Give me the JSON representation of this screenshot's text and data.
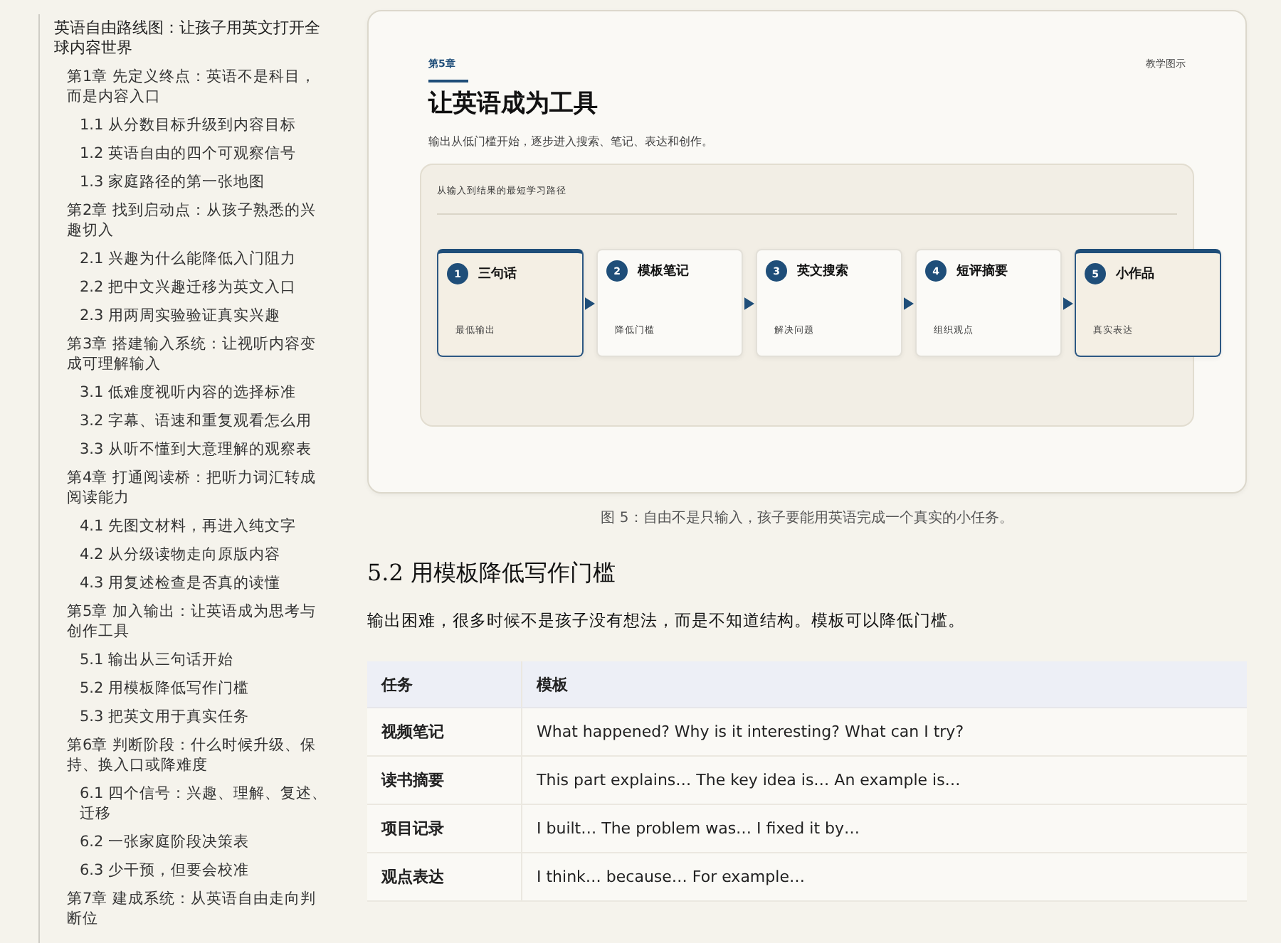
{
  "sidebar": {
    "toc": [
      {
        "label": "英语自由路线图：让孩子用英文打开全球内容世界",
        "children": [
          {
            "label": "第1章 先定义终点：英语不是科目，而是内容入口",
            "children": [
              {
                "label": "1.1 从分数目标升级到内容目标"
              },
              {
                "label": "1.2 英语自由的四个可观察信号"
              },
              {
                "label": "1.3 家庭路径的第一张地图"
              }
            ]
          },
          {
            "label": "第2章 找到启动点：从孩子熟悉的兴趣切入",
            "children": [
              {
                "label": "2.1 兴趣为什么能降低入门阻力"
              },
              {
                "label": "2.2 把中文兴趣迁移为英文入口"
              },
              {
                "label": "2.3 用两周实验验证真实兴趣"
              }
            ]
          },
          {
            "label": "第3章 搭建输入系统：让视听内容变成可理解输入",
            "children": [
              {
                "label": "3.1 低难度视听内容的选择标准"
              },
              {
                "label": "3.2 字幕、语速和重复观看怎么用"
              },
              {
                "label": "3.3 从听不懂到大意理解的观察表"
              }
            ]
          },
          {
            "label": "第4章 打通阅读桥：把听力词汇转成阅读能力",
            "children": [
              {
                "label": "4.1 先图文材料，再进入纯文字"
              },
              {
                "label": "4.2 从分级读物走向原版内容"
              },
              {
                "label": "4.3 用复述检查是否真的读懂"
              }
            ]
          },
          {
            "label": "第5章 加入输出：让英语成为思考与创作工具",
            "children": [
              {
                "label": "5.1 输出从三句话开始"
              },
              {
                "label": "5.2 用模板降低写作门槛"
              },
              {
                "label": "5.3 把英文用于真实任务"
              }
            ]
          },
          {
            "label": "第6章 判断阶段：什么时候升级、保持、换入口或降难度",
            "children": [
              {
                "label": "6.1 四个信号：兴趣、理解、复述、迁移"
              },
              {
                "label": "6.2 一张家庭阶段决策表"
              },
              {
                "label": "6.3 少干预，但要会校准"
              }
            ]
          },
          {
            "label": "第7章 建成系统：从英语自由走向判断位"
          }
        ]
      }
    ]
  },
  "figure": {
    "chapter": "第5章",
    "tag": "教学图示",
    "title": "让英语成为工具",
    "subtitle": "输出从低门槛开始，逐步进入搜索、笔记、表达和创作。",
    "panel_title": "从输入到结果的最短学习路径",
    "steps": [
      {
        "number": "1",
        "title": "三句话",
        "note": "最低输出",
        "highlighted": true
      },
      {
        "number": "2",
        "title": "模板笔记",
        "note": "降低门槛",
        "highlighted": false
      },
      {
        "number": "3",
        "title": "英文搜索",
        "note": "解决问题",
        "highlighted": false
      },
      {
        "number": "4",
        "title": "短评摘要",
        "note": "组织观点",
        "highlighted": false
      },
      {
        "number": "5",
        "title": "小作品",
        "note": "真实表达",
        "highlighted": true
      }
    ],
    "caption": "图 5：自由不是只输入，孩子要能用英语完成一个真实的小任务。"
  },
  "section": {
    "heading": "5.2 用模板降低写作门槛",
    "paragraph": "输出困难，很多时候不是孩子没有想法，而是不知道结构。模板可以降低门槛。"
  },
  "table": {
    "columns": [
      "任务",
      "模板"
    ],
    "rows": [
      [
        "视频笔记",
        "What happened? Why is it interesting? What can I try?"
      ],
      [
        "读书摘要",
        "This part explains… The key idea is… An example is…"
      ],
      [
        "项目记录",
        "I built… The problem was… I fixed it by…"
      ],
      [
        "观点表达",
        "I think… because… For example…"
      ]
    ]
  }
}
